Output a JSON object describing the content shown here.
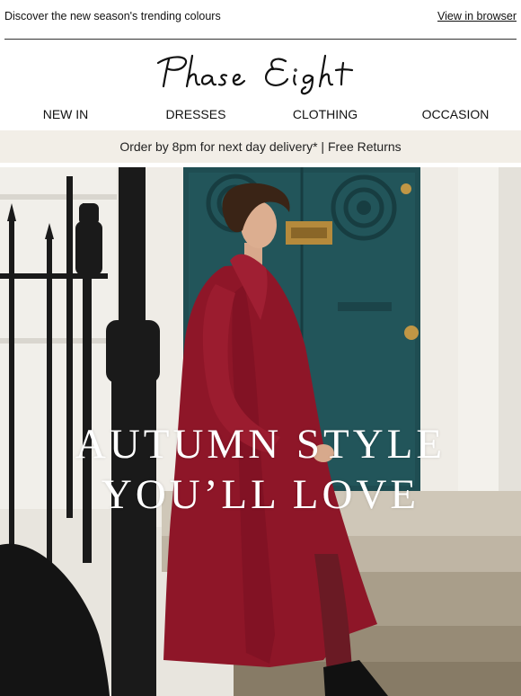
{
  "preheader": {
    "text": "Discover the new season's trending colours",
    "browser_link": "View in browser"
  },
  "brand": {
    "logo_text": "Phase Eight"
  },
  "nav": {
    "items": [
      "NEW IN",
      "DRESSES",
      "CLOTHING",
      "OCCASION"
    ]
  },
  "promo": {
    "text": "Order by 8pm for next day delivery* | Free Returns"
  },
  "hero": {
    "headline_line1": "AUTUMN STYLE",
    "headline_line2": "YOU’LL LOVE",
    "image_description_icon": "woman-in-red-coat-photo"
  },
  "colors": {
    "promo_bg": "#f2eee7",
    "coat_red": "#8e1628",
    "door_teal": "#1f4d52",
    "headline": "#ffffff"
  }
}
